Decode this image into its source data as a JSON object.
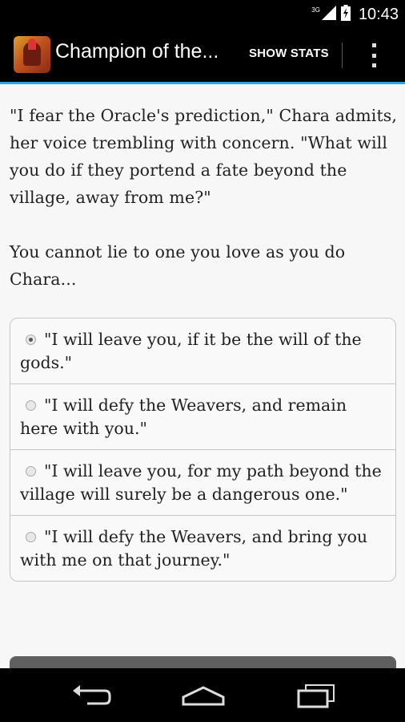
{
  "status_bar": {
    "network_label": "3G",
    "time": "10:43"
  },
  "action_bar": {
    "app_title": "Champion of the...",
    "show_stats_label": "SHOW STATS",
    "accent_color": "#2aa6da"
  },
  "story": {
    "paragraphs": [
      "\"I fear the Oracle's prediction,\" Chara admits, her voice trembling with concern. \"What will you do if they portend a fate beyond the village, away from me?\"",
      "You cannot lie to one you love as you do Chara..."
    ]
  },
  "choices": [
    {
      "label": "\"I will leave you, if it be the will of the gods.\"",
      "selected": true
    },
    {
      "label": "\"I will defy the Weavers, and remain here with you.\"",
      "selected": false
    },
    {
      "label": "\"I will leave you, for my path beyond the village will surely be a dangerous one.\"",
      "selected": false
    },
    {
      "label": "\"I will defy the Weavers, and bring you with me on that journey.\"",
      "selected": false
    }
  ],
  "nav_bar": {
    "icons": [
      "back-icon",
      "home-icon",
      "recents-icon"
    ]
  }
}
